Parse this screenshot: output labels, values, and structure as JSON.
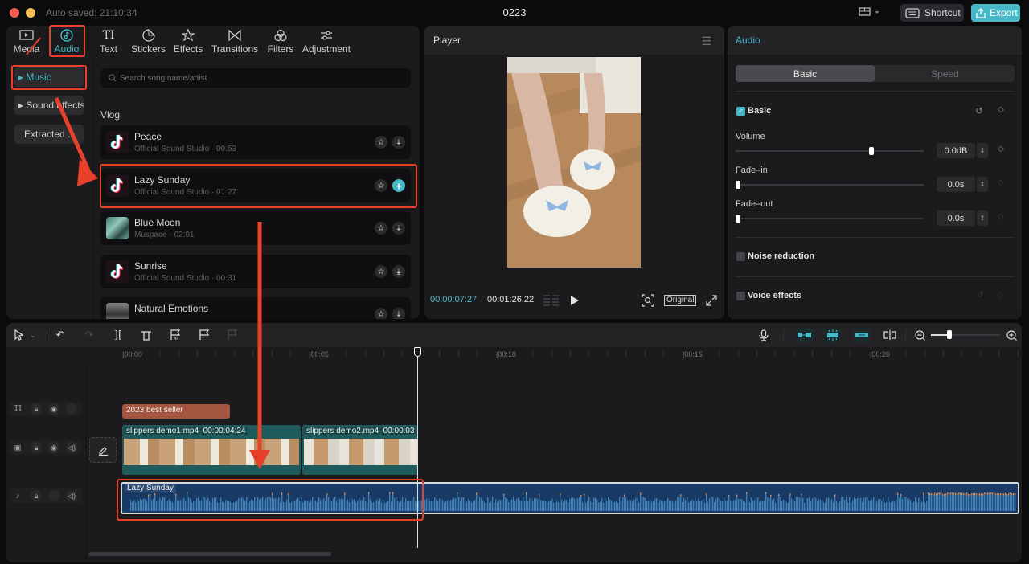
{
  "titlebar": {
    "autosave": "Auto saved: 21:10:34",
    "title": "0223",
    "layout_icon": "layout-icon",
    "shortcut_label": "Shortcut",
    "export_label": "Export"
  },
  "tool_tabs": [
    {
      "label": "Media",
      "icon": "media-icon",
      "active": false
    },
    {
      "label": "Audio",
      "icon": "audio-icon",
      "active": true
    },
    {
      "label": "Text",
      "icon": "text-icon",
      "active": false
    },
    {
      "label": "Stickers",
      "icon": "stickers-icon",
      "active": false
    },
    {
      "label": "Effects",
      "icon": "effects-icon",
      "active": false
    },
    {
      "label": "Transitions",
      "icon": "transitions-icon",
      "active": false
    },
    {
      "label": "Filters",
      "icon": "filters-icon",
      "active": false
    },
    {
      "label": "Adjustment",
      "icon": "adjustment-icon",
      "active": false
    }
  ],
  "sidebar": {
    "items": [
      {
        "label": "▸ Music",
        "active": true
      },
      {
        "label": "▸ Sound effects",
        "active": false
      },
      {
        "label": "Extracted ...",
        "active": false
      }
    ]
  },
  "library": {
    "search_placeholder": "Search song name/artist",
    "category": "Vlog",
    "songs": [
      {
        "name": "Peace",
        "meta": "Official Sound Studio · 00:53",
        "thumb": "tiktok-logo",
        "action": "download"
      },
      {
        "name": "Lazy Sunday",
        "meta": "Official Sound Studio · 01:27",
        "thumb": "tiktok-logo",
        "action": "add"
      },
      {
        "name": "Blue Moon",
        "meta": "Muspace · 02:01",
        "thumb": "album-art",
        "action": "download"
      },
      {
        "name": "Sunrise",
        "meta": "Official Sound Studio · 00:31",
        "thumb": "tiktok-logo",
        "action": "download"
      },
      {
        "name": "Natural Emotions",
        "meta": "",
        "thumb": "album-art-bw",
        "action": "download"
      }
    ]
  },
  "player": {
    "title": "Player",
    "current_time": "00:00:07:27",
    "separator": "/",
    "total_time": "00:01:26:22",
    "ratio_label": "Original"
  },
  "properties": {
    "title": "Audio",
    "tabs": [
      {
        "label": "Basic",
        "active": true
      },
      {
        "label": "Speed",
        "active": false
      }
    ],
    "basic_section": {
      "label": "Basic",
      "checked": true
    },
    "volume": {
      "label": "Volume",
      "value": "0.0dB",
      "position": 0.73
    },
    "fade_in": {
      "label": "Fade–in",
      "value": "0.0s",
      "position": 0.0
    },
    "fade_out": {
      "label": "Fade–out",
      "value": "0.0s",
      "position": 0.0
    },
    "noise_reduction": {
      "label": "Noise reduction",
      "checked": false
    },
    "voice_effects": {
      "label": "Voice effects",
      "checked": false
    }
  },
  "timeline": {
    "ruler": [
      "00:00",
      "00:05",
      "00:10",
      "00:15",
      "00:20"
    ],
    "zoom_level": 0.27,
    "tracks": {
      "text_clip": "2023 best seller",
      "video_clips": [
        {
          "name": "slippers demo1.mp4",
          "duration": "00:00:04:24"
        },
        {
          "name": "slippers demo2.mp4",
          "duration": "00:00:03"
        }
      ],
      "audio_clip": "Lazy Sunday"
    }
  },
  "colors": {
    "accent": "#47b8c8",
    "annotation": "#e8412b",
    "text_clip": "#a4553f",
    "video_clip": "#1f5b5c",
    "audio_clip": "#1a3a66"
  }
}
